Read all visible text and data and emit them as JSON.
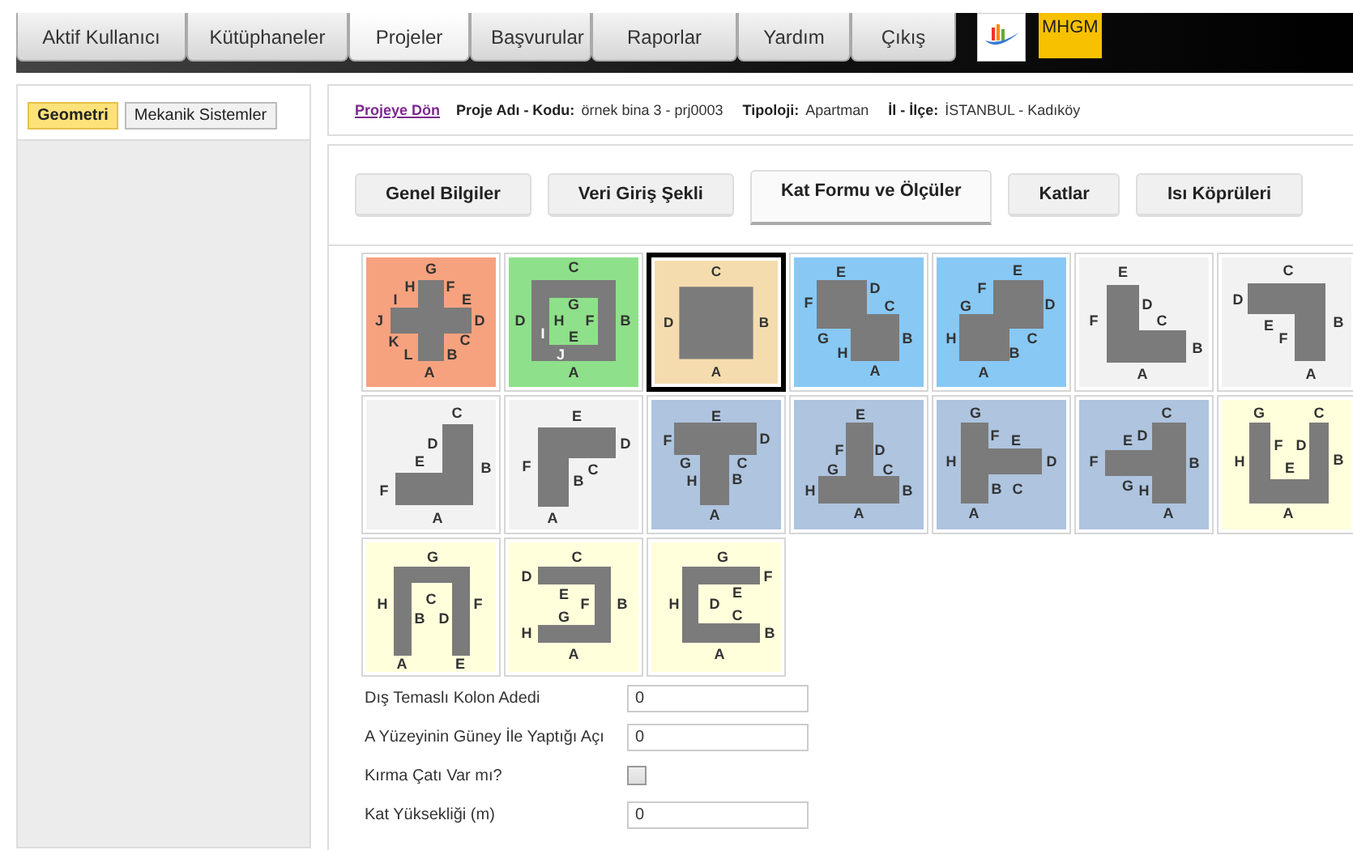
{
  "nav": {
    "tabs": [
      {
        "label": "Aktif Kullanıcı",
        "selected": false
      },
      {
        "label": "Kütüphaneler",
        "selected": false
      },
      {
        "label": "Projeler",
        "selected": true
      },
      {
        "label": "Başvurular",
        "selected": false
      },
      {
        "label": "Raporlar",
        "selected": false
      },
      {
        "label": "Yardım",
        "selected": false
      },
      {
        "label": "Çıkış",
        "selected": false
      }
    ],
    "logo_text": "MHGM"
  },
  "sidebar": {
    "tabs": [
      {
        "label": "Geometri",
        "selected": true
      },
      {
        "label": "Mekanik Sistemler",
        "selected": false
      }
    ]
  },
  "header": {
    "back_link": "Projeye Dön",
    "fields": [
      {
        "label": "Proje Adı - Kodu:",
        "value": "örnek bina 3 - prj0003"
      },
      {
        "label": "Tipoloji:",
        "value": "Apartman"
      },
      {
        "label": "İl - İlçe:",
        "value": "İSTANBUL - Kadıköy"
      }
    ]
  },
  "section_tabs": [
    {
      "label": "Genel Bilgiler",
      "selected": false
    },
    {
      "label": "Veri Giriş Şekli",
      "selected": false
    },
    {
      "label": "Kat Formu ve Ölçüler",
      "selected": true
    },
    {
      "label": "Katlar",
      "selected": false
    },
    {
      "label": "Isı Köprüleri",
      "selected": false
    }
  ],
  "shapes": [
    {
      "kind": "plus",
      "color": "#f7a27f",
      "selected": false,
      "labels": [
        "G",
        "H",
        "F",
        "I",
        "E",
        "J",
        "D",
        "K",
        "C",
        "L",
        "B",
        "A"
      ]
    },
    {
      "kind": "ring",
      "color": "#8ee08a",
      "selected": false,
      "labels": [
        "C",
        "G",
        "D",
        "H",
        "F",
        "B",
        "I",
        "E",
        "J",
        "A"
      ]
    },
    {
      "kind": "square",
      "color": "#f5dcae",
      "selected": true,
      "labels": [
        "C",
        "D",
        "B",
        "A"
      ]
    },
    {
      "kind": "z",
      "color": "#88c8f4",
      "selected": false,
      "labels": [
        "E",
        "D",
        "F",
        "C",
        "G",
        "B",
        "H",
        "A"
      ]
    },
    {
      "kind": "s",
      "color": "#88c8f4",
      "selected": false,
      "labels": [
        "E",
        "F",
        "G",
        "D",
        "H",
        "C",
        "B",
        "A"
      ]
    },
    {
      "kind": "l",
      "color": "#f2f2f2",
      "selected": false,
      "labels": [
        "E",
        "F",
        "D",
        "C",
        "B",
        "A"
      ]
    },
    {
      "kind": "j_top",
      "color": "#f2f2f2",
      "selected": false,
      "labels": [
        "C",
        "D",
        "E",
        "B",
        "F",
        "A"
      ]
    },
    {
      "kind": "j",
      "color": "#f2f2f2",
      "selected": false,
      "labels": [
        "C",
        "D",
        "E",
        "B",
        "F",
        "A"
      ]
    },
    {
      "kind": "gamma",
      "color": "#f2f2f2",
      "selected": false,
      "labels": [
        "E",
        "D",
        "F",
        "C",
        "B",
        "A"
      ]
    },
    {
      "kind": "t",
      "color": "#aec4df",
      "selected": false,
      "labels": [
        "E",
        "F",
        "D",
        "G",
        "C",
        "H",
        "B",
        "A"
      ]
    },
    {
      "kind": "t_inv",
      "color": "#aec4df",
      "selected": false,
      "labels": [
        "E",
        "F",
        "D",
        "G",
        "C",
        "H",
        "B",
        "A"
      ]
    },
    {
      "kind": "t_right",
      "color": "#aec4df",
      "selected": false,
      "labels": [
        "G",
        "F",
        "E",
        "H",
        "D",
        "B",
        "C",
        "A"
      ]
    },
    {
      "kind": "t_left",
      "color": "#aec4df",
      "selected": false,
      "labels": [
        "C",
        "E",
        "D",
        "F",
        "B",
        "G",
        "H",
        "A"
      ]
    },
    {
      "kind": "u",
      "color": "#ffffdc",
      "selected": false,
      "labels": [
        "G",
        "C",
        "F",
        "D",
        "H",
        "B",
        "E",
        "A"
      ]
    },
    {
      "kind": "n",
      "color": "#ffffdc",
      "selected": false,
      "labels": [
        "G",
        "H",
        "C",
        "F",
        "B",
        "D",
        "A",
        "E"
      ]
    },
    {
      "kind": "c_rev",
      "color": "#ffffdc",
      "selected": false,
      "labels": [
        "C",
        "D",
        "E",
        "F",
        "B",
        "G",
        "H",
        "A"
      ]
    },
    {
      "kind": "c",
      "color": "#ffffdc",
      "selected": false,
      "labels": [
        "G",
        "F",
        "E",
        "H",
        "D",
        "C",
        "B",
        "A"
      ]
    }
  ],
  "form": [
    {
      "kind": "text",
      "label": "Dış Temaslı Kolon Adedi",
      "value": "0"
    },
    {
      "kind": "text",
      "label": "A Yüzeyinin Güney İle Yaptığı Açı",
      "value": "0"
    },
    {
      "kind": "checkbox",
      "label": "Kırma Çatı Var mı?",
      "checked": false
    },
    {
      "kind": "text",
      "label": "Kat Yüksekliği (m)",
      "value": "0"
    }
  ]
}
